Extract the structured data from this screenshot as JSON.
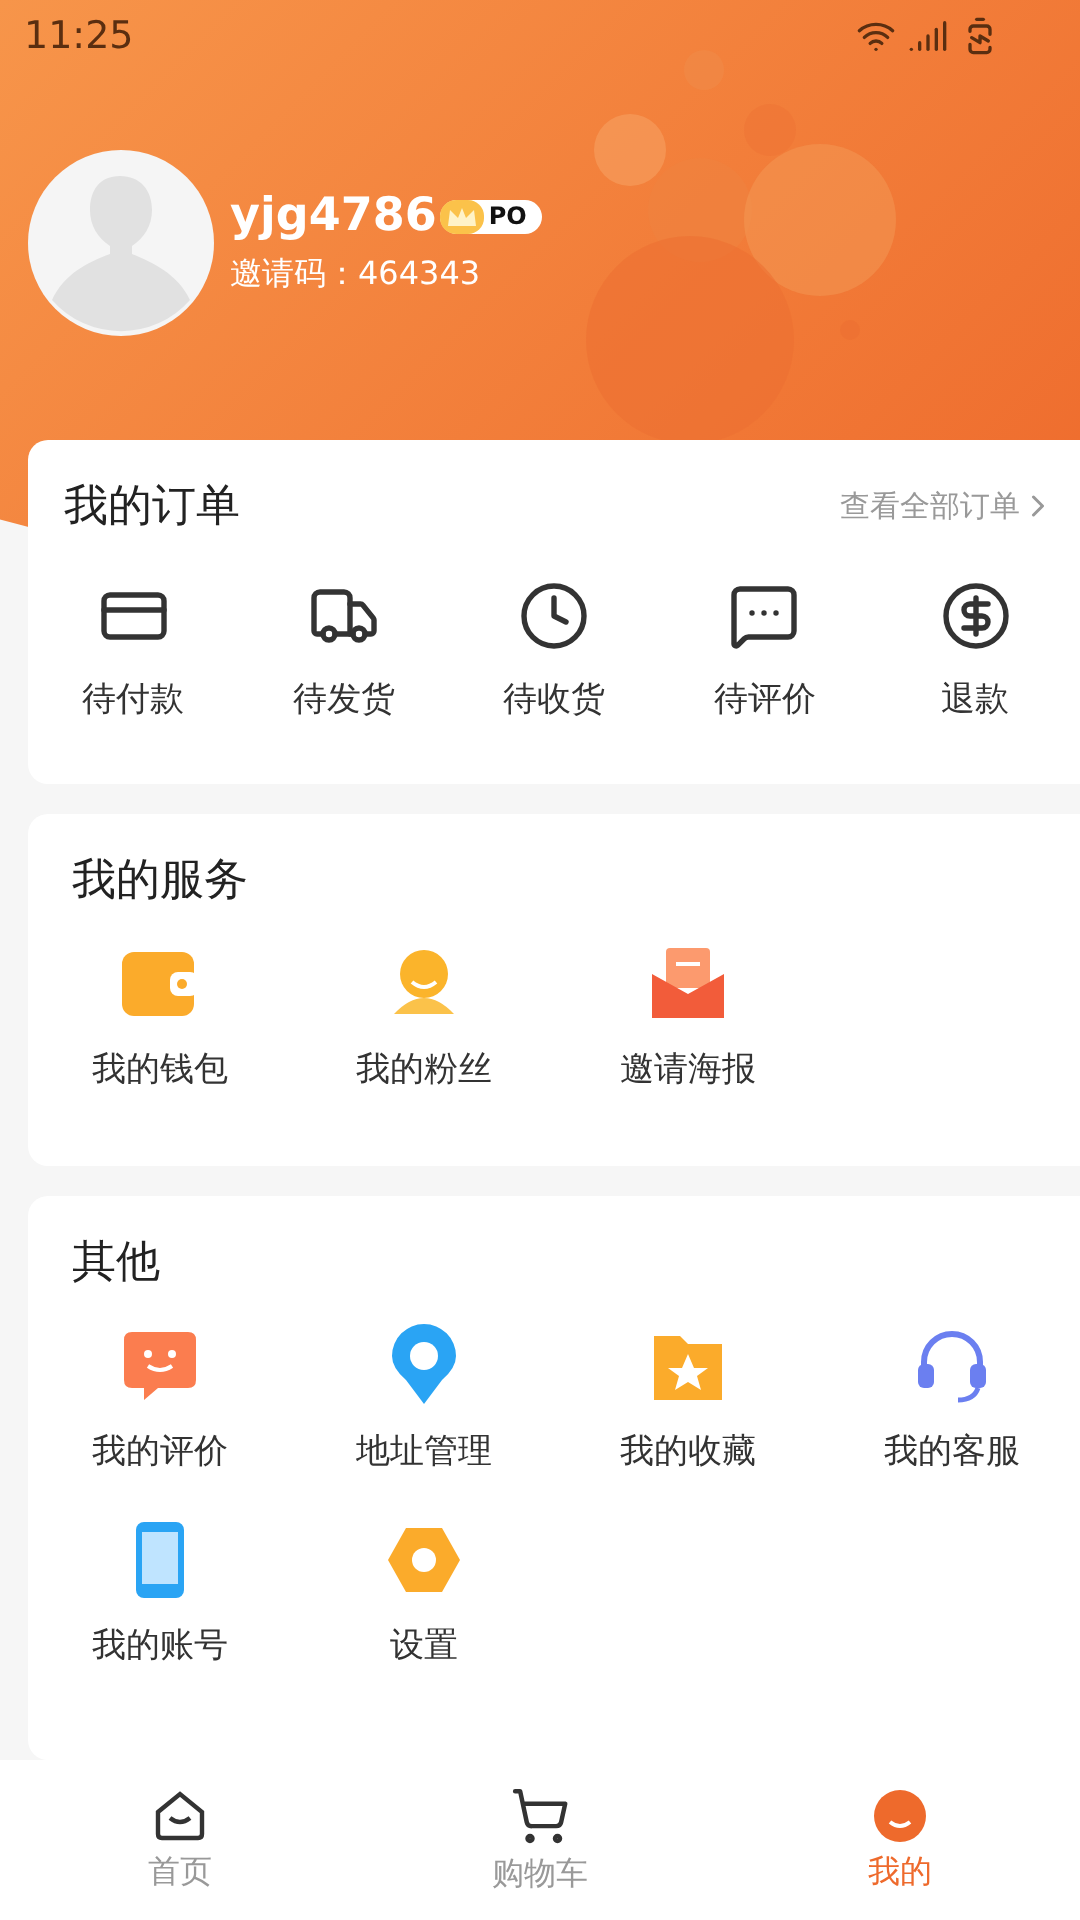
{
  "status_bar": {
    "time": "11:25"
  },
  "profile": {
    "username": "yjg4786",
    "badge": "PO",
    "invite_code": "邀请码：464343"
  },
  "orders": {
    "title": "我的订单",
    "view_all": "查看全部订单",
    "items": [
      {
        "label": "待付款",
        "kind": "card"
      },
      {
        "label": "待发货",
        "kind": "truck"
      },
      {
        "label": "待收货",
        "kind": "clock"
      },
      {
        "label": "待评价",
        "kind": "chat"
      },
      {
        "label": "退款",
        "kind": "refund"
      }
    ]
  },
  "services": {
    "title": "我的服务",
    "items": [
      {
        "label": "我的钱包",
        "kind": "wallet"
      },
      {
        "label": "我的粉丝",
        "kind": "fans"
      },
      {
        "label": "邀请海报",
        "kind": "poster"
      }
    ]
  },
  "others": {
    "title": "其他",
    "items": [
      {
        "label": "我的评价",
        "kind": "review"
      },
      {
        "label": "地址管理",
        "kind": "location"
      },
      {
        "label": "我的收藏",
        "kind": "favorite"
      },
      {
        "label": "我的客服",
        "kind": "headset"
      },
      {
        "label": "我的账号",
        "kind": "phone"
      },
      {
        "label": "设置",
        "kind": "settings"
      }
    ]
  },
  "tab_bar": [
    {
      "label": "首页",
      "kind": "home",
      "selected": false
    },
    {
      "label": "购物车",
      "kind": "cart",
      "selected": false
    },
    {
      "label": "我的",
      "kind": "me",
      "selected": true
    }
  ]
}
